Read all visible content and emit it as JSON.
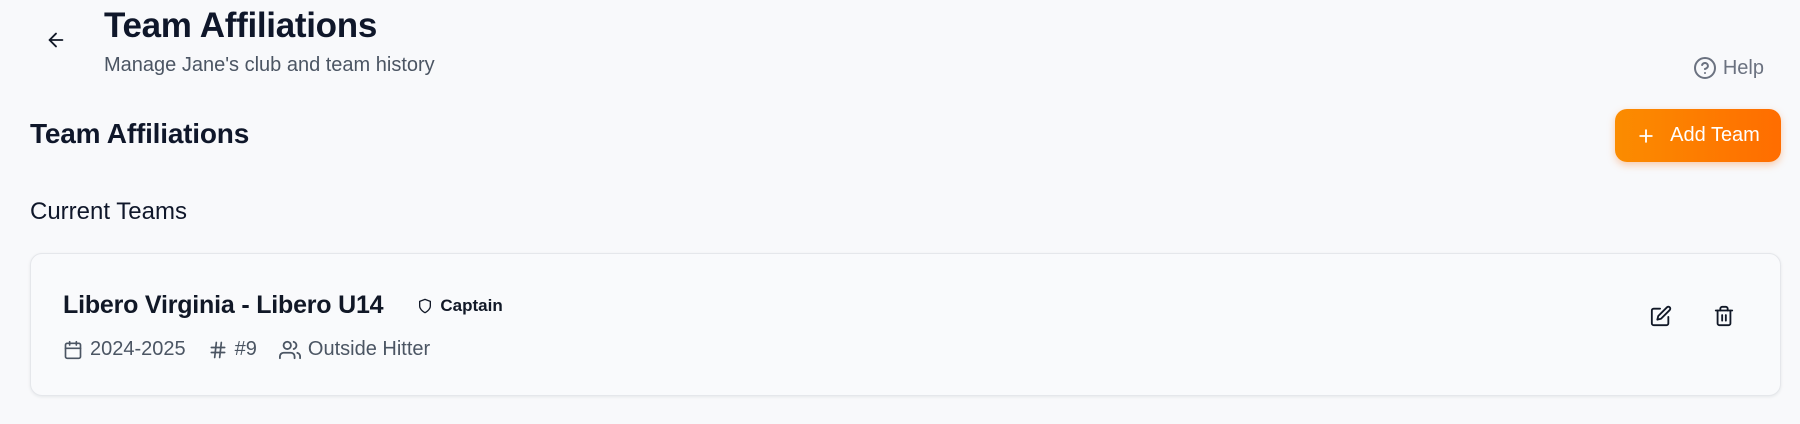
{
  "header": {
    "title": "Team Affiliations",
    "subtitle": "Manage Jane's club and team history",
    "help_label": "Help"
  },
  "section": {
    "title": "Team Affiliations",
    "add_button_label": "Add Team"
  },
  "current_teams": {
    "title": "Current Teams",
    "teams": [
      {
        "name": "Libero Virginia - Libero U14",
        "role": "Captain",
        "season": "2024-2025",
        "jersey": "#9",
        "position": "Outside Hitter"
      }
    ]
  },
  "icons": {
    "back": "arrow-left-icon",
    "help": "help-circle-icon",
    "add": "plus-icon",
    "role": "shield-icon",
    "season": "calendar-icon",
    "jersey": "hash-icon",
    "position": "users-icon",
    "edit": "edit-icon",
    "delete": "trash-icon"
  },
  "colors": {
    "accent_start": "#fb8c00",
    "accent_end": "#ff6d00",
    "text_primary": "#0f172a",
    "text_secondary": "#4b5563"
  }
}
